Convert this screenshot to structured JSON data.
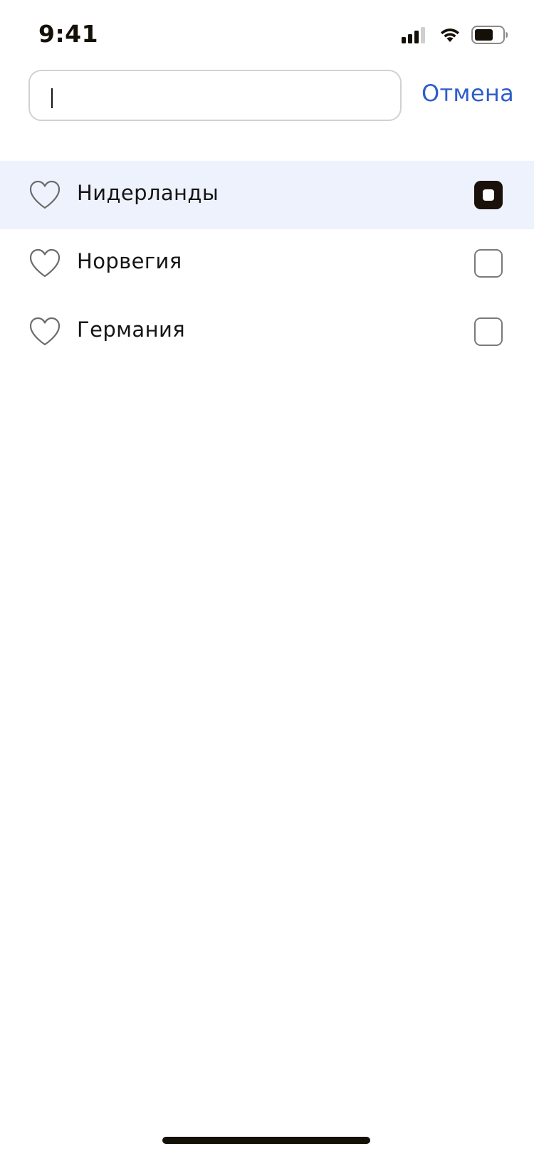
{
  "status_bar": {
    "time": "9:41",
    "icons": [
      "cellular-signal-icon",
      "wifi-icon",
      "battery-icon"
    ]
  },
  "search": {
    "value": "",
    "placeholder": "",
    "cancel_label": "Отмена"
  },
  "countries": [
    {
      "label": "Нидерланды",
      "favorite": false,
      "checked": true,
      "highlighted": true
    },
    {
      "label": "Норвегия",
      "favorite": false,
      "checked": false,
      "highlighted": false
    },
    {
      "label": "Германия",
      "favorite": false,
      "checked": false,
      "highlighted": false
    }
  ],
  "colors": {
    "accent": "#2e5dcb",
    "selected_row": "#eef2fd",
    "checkbox_checked": "#1a120a"
  }
}
